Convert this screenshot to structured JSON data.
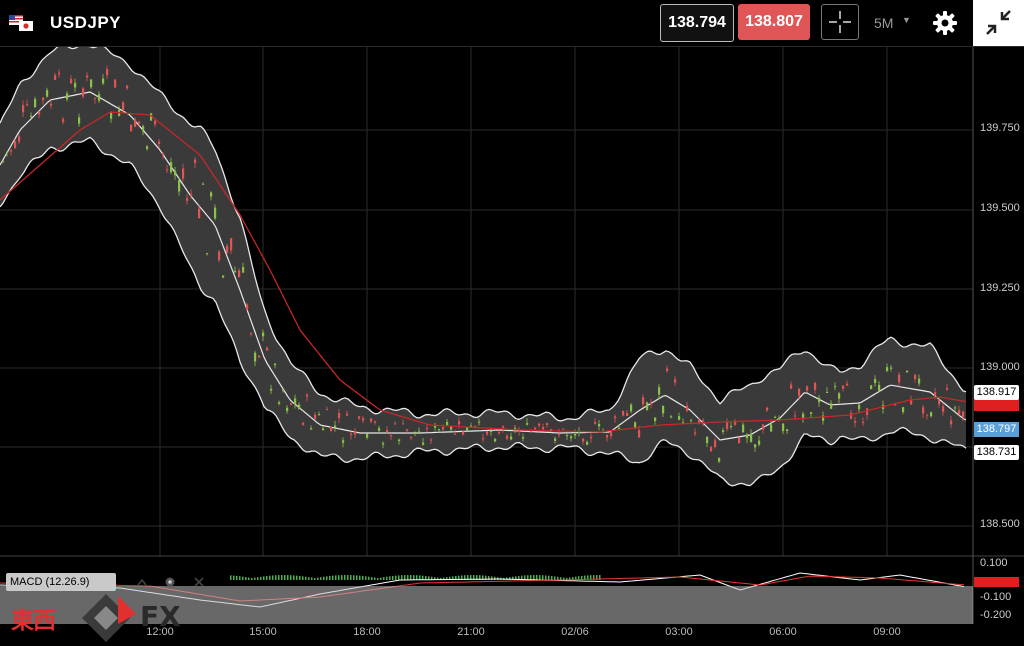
{
  "header": {
    "symbol": "USDJPY",
    "bid": "138.794",
    "ask": "138.807",
    "timeframe": "5M"
  },
  "y_axis": {
    "labels": [
      "139.750",
      "139.500",
      "139.250",
      "139.000",
      "138.500"
    ]
  },
  "price_tags": [
    "138.917",
    "138.797",
    "138.731"
  ],
  "macd": {
    "label": "MACD (12.26.9)",
    "axis_labels": [
      "0.100",
      "-0.100",
      "-0.200"
    ]
  },
  "x_axis": {
    "labels": [
      "12:00",
      "15:00",
      "18:00",
      "21:00",
      "02/06",
      "03:00",
      "06:00",
      "09:00"
    ]
  },
  "logo": {
    "kanji": "東西",
    "fx": "FX"
  },
  "colors": {
    "ask_bg": "#e05656",
    "up_candle": "#8bc34a",
    "down_candle": "#e05656",
    "ma_line": "#c62828",
    "band_fill": "#3a3a3a",
    "logo_red": "#e03030"
  }
}
